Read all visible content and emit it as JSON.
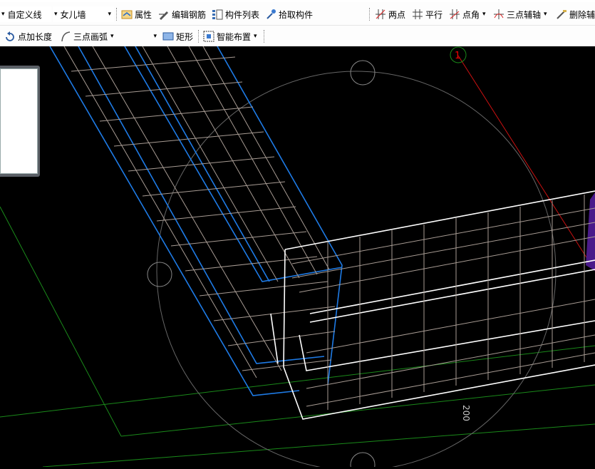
{
  "toolbar1": {
    "axis_combo": "自定义线",
    "member_combo": "女儿墙",
    "properties": "属性",
    "edit_rebar": "编辑钢筋",
    "member_list": "构件列表",
    "pick_member": "拾取构件",
    "two_points": "两点",
    "parallel": "平行",
    "point_angle": "点角",
    "three_point_aux": "三点辅轴",
    "delete_aux": "删除辅"
  },
  "toolbar2": {
    "point_length": "点加长度",
    "three_point_arc": "三点画弧",
    "rectangle": "矩形",
    "smart_layout": "智能布置"
  },
  "canvas": {
    "axis_label": "1",
    "dimension_label": "200",
    "colors": {
      "background": "#000000",
      "selected_wall": "#1e7be6",
      "rebar": "#a89c94",
      "wall_outline": "#ffffff",
      "grid": "#1a8a1a",
      "axis_line": "#cc1111"
    }
  }
}
